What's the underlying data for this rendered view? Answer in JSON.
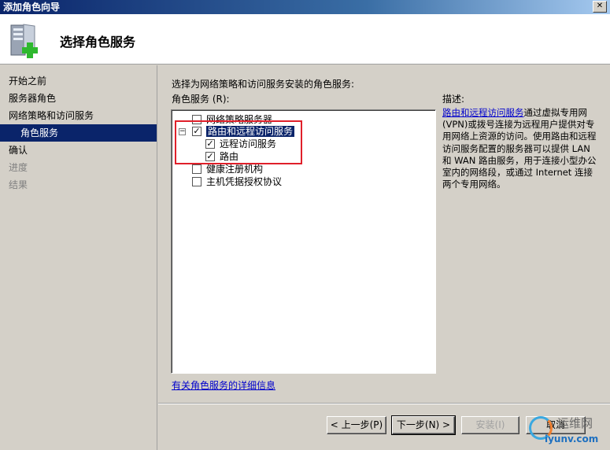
{
  "window": {
    "title": "添加角色向导",
    "close_glyph": "✕"
  },
  "header": {
    "title": "选择角色服务",
    "icon": "server-add-icon"
  },
  "sidebar": {
    "items": [
      {
        "label": "开始之前",
        "state": "normal"
      },
      {
        "label": "服务器角色",
        "state": "normal"
      },
      {
        "label": "网络策略和访问服务",
        "state": "normal"
      },
      {
        "label": "角色服务",
        "state": "active"
      },
      {
        "label": "确认",
        "state": "normal"
      },
      {
        "label": "进度",
        "state": "disabled"
      },
      {
        "label": "结果",
        "state": "disabled"
      }
    ]
  },
  "main": {
    "instruction": "选择为网络策略和访问服务安装的角色服务:",
    "list_label": "角色服务 (R):",
    "services": [
      {
        "label": "网络策略服务器",
        "checked": false
      },
      {
        "label": "路由和远程访问服务",
        "checked": true,
        "expander": "−"
      },
      {
        "label": "远程访问服务",
        "checked": true
      },
      {
        "label": "路由",
        "checked": true
      },
      {
        "label": "健康注册机构",
        "checked": false
      },
      {
        "label": "主机凭据授权协议",
        "checked": false
      }
    ],
    "description_label": "描述:",
    "description_link": "路由和远程访问服务",
    "description_text": "通过虚拟专用网(VPN)或拨号连接为远程用户提供对专用网络上资源的访问。使用路由和远程访问服务配置的服务器可以提供 LAN 和 WAN 路由服务，用于连接小型办公室内的网络段，或通过 Internet 连接两个专用网络。",
    "more_info_link": "有关角色服务的详细信息"
  },
  "buttons": {
    "back": "< 上一步(P)",
    "next": "下一步(N) >",
    "install": "安装(I)",
    "cancel": "取消"
  },
  "watermark": {
    "line1": "运维网",
    "line2": "iyunv.com"
  },
  "colors": {
    "selection": "#0a246a",
    "highlight_box": "#e0202a",
    "link": "#0000cc"
  }
}
